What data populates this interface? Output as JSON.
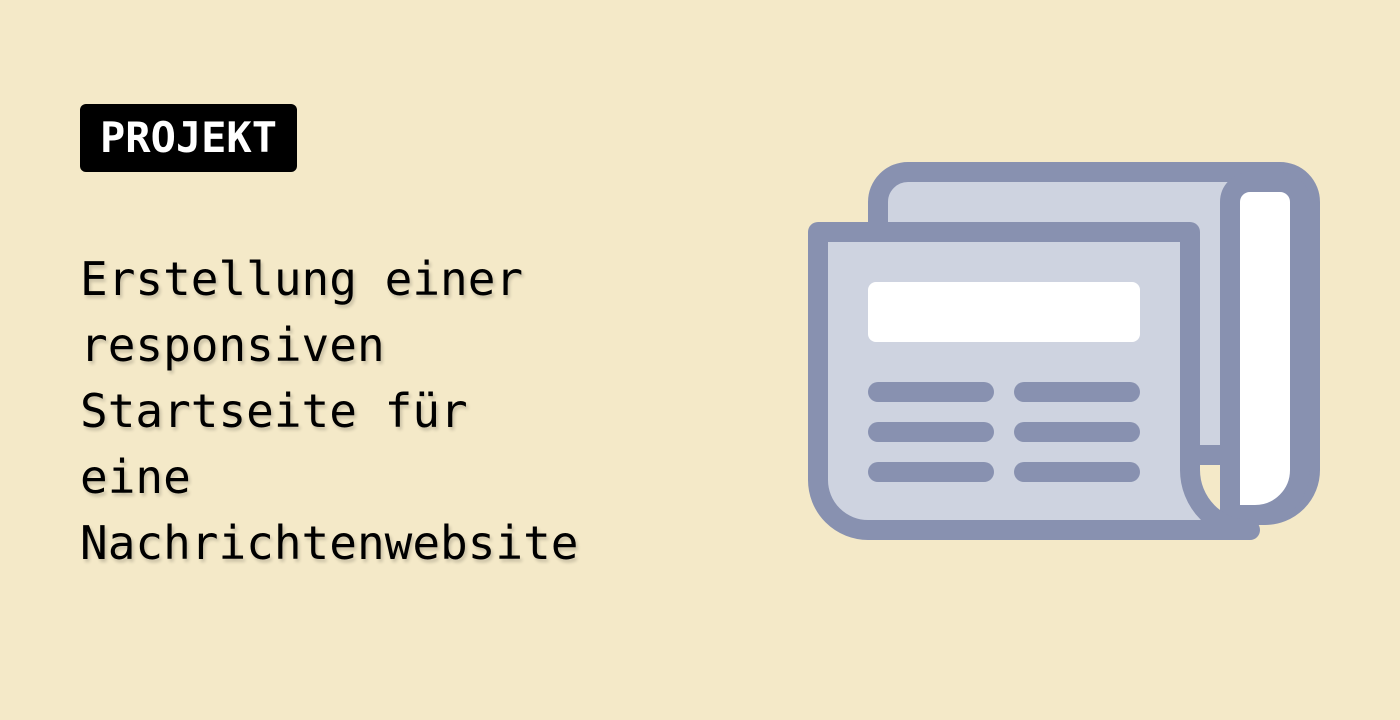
{
  "badge": {
    "label": "PROJEKT"
  },
  "title": {
    "lines": [
      "Erstellung einer",
      "responsiven",
      "Startseite für",
      "eine",
      "Nachrichtenwebsite"
    ]
  },
  "illustration": {
    "icon": "newspaper-icon"
  },
  "colors": {
    "background": "#f4e9c8",
    "badge_background": "#000000",
    "badge_text": "#ffffff",
    "title_text": "#000000",
    "icon_stroke": "#8891b0",
    "icon_fill": "#ced3e0",
    "icon_highlight": "#ffffff"
  }
}
